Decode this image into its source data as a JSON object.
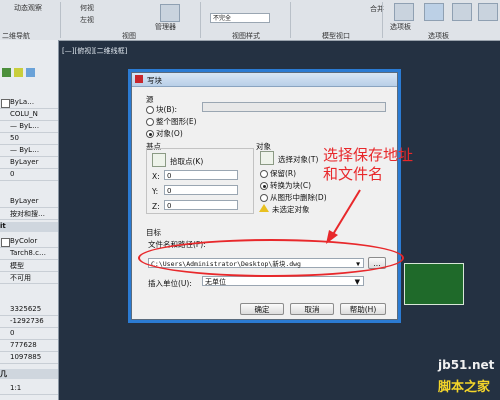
{
  "ribbon": {
    "items": [
      "动态观察",
      "何视",
      "左视",
      "管理器",
      "不完全",
      "合并",
      "选项板"
    ],
    "groups": [
      "二维导航",
      "视图",
      "视图样式",
      "模型视口",
      "选项板"
    ]
  },
  "palette": {
    "rows": [
      "ByLa…",
      "COLU_N",
      "— ByL…",
      "50",
      "— ByL…",
      "ByLayer",
      "0",
      "ByLayer",
      "按对和搜…",
      "ByColor",
      "Tarch8.c…",
      "模型",
      "不可用",
      "3325625",
      "-1292736",
      "0",
      "777628",
      "1097885",
      "1:1"
    ],
    "header_it": "it",
    "header_bottom": "几"
  },
  "viewport_label": "[—][俯视][二维线框]",
  "dialog": {
    "title": "写块",
    "source_label": "源",
    "radio_block": "块(B):",
    "radio_whole": "整个图形(E)",
    "radio_object": "对象(O)",
    "basepoint_label": "基点",
    "pick_point": "拾取点(K)",
    "x_label": "X:",
    "x_value": "0",
    "y_label": "Y:",
    "y_value": "0",
    "z_label": "Z:",
    "z_value": "0",
    "objects_label": "对象",
    "select_objects": "选择对象(T)",
    "retain": "保留(R)",
    "convert": "转换为块(C)",
    "delete": "从图形中删除(D)",
    "warning": "未选定对象",
    "target_label": "目标",
    "filename_label": "文件名和路径(F):",
    "filename_value": "C:\\Users\\Administrator\\Desktop\\新块.dwg",
    "browse": "...",
    "units_label": "插入单位(U):",
    "units_value": "无单位",
    "ok": "确定",
    "cancel": "取消",
    "help": "帮助(H)"
  },
  "annotation": "选择保存地址\n和文件名",
  "watermark": {
    "site": "jb51.net",
    "name": "脚本之家"
  },
  "colors": {
    "annotation": "#e8282b",
    "dialog_highlight": "#2b7bd3",
    "background": "#243142"
  }
}
